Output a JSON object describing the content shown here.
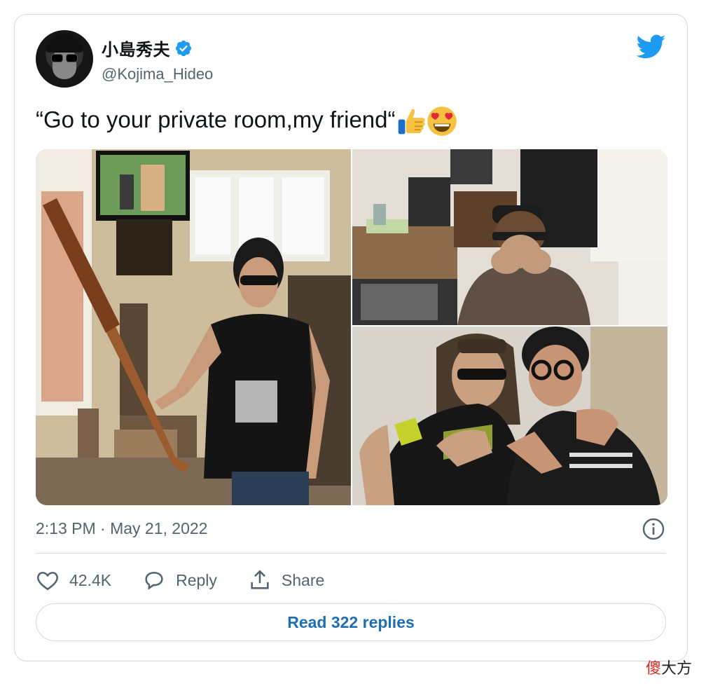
{
  "author": {
    "display_name": "小島秀夫",
    "handle": "@Kojima_Hideo",
    "verified": true,
    "avatar_icon": "avatar-photo"
  },
  "tweet": {
    "text": "“Go to your private room,my friend“",
    "emojis": [
      "thumbs-up-emoji",
      "heart-eyes-emoji"
    ]
  },
  "media": {
    "count": 3
  },
  "meta": {
    "timestamp": "2:13 PM · May 21, 2022"
  },
  "actions": {
    "like_count": "42.4K",
    "reply_label": "Reply",
    "share_label": "Share"
  },
  "replies_button": "Read 322 replies",
  "watermark": {
    "first": "傻",
    "rest": "大方"
  },
  "colors": {
    "twitter_blue": "#1d9bf0",
    "link_blue": "#1d6fb5",
    "secondary_text": "#536471",
    "border": "#cfd9de"
  }
}
